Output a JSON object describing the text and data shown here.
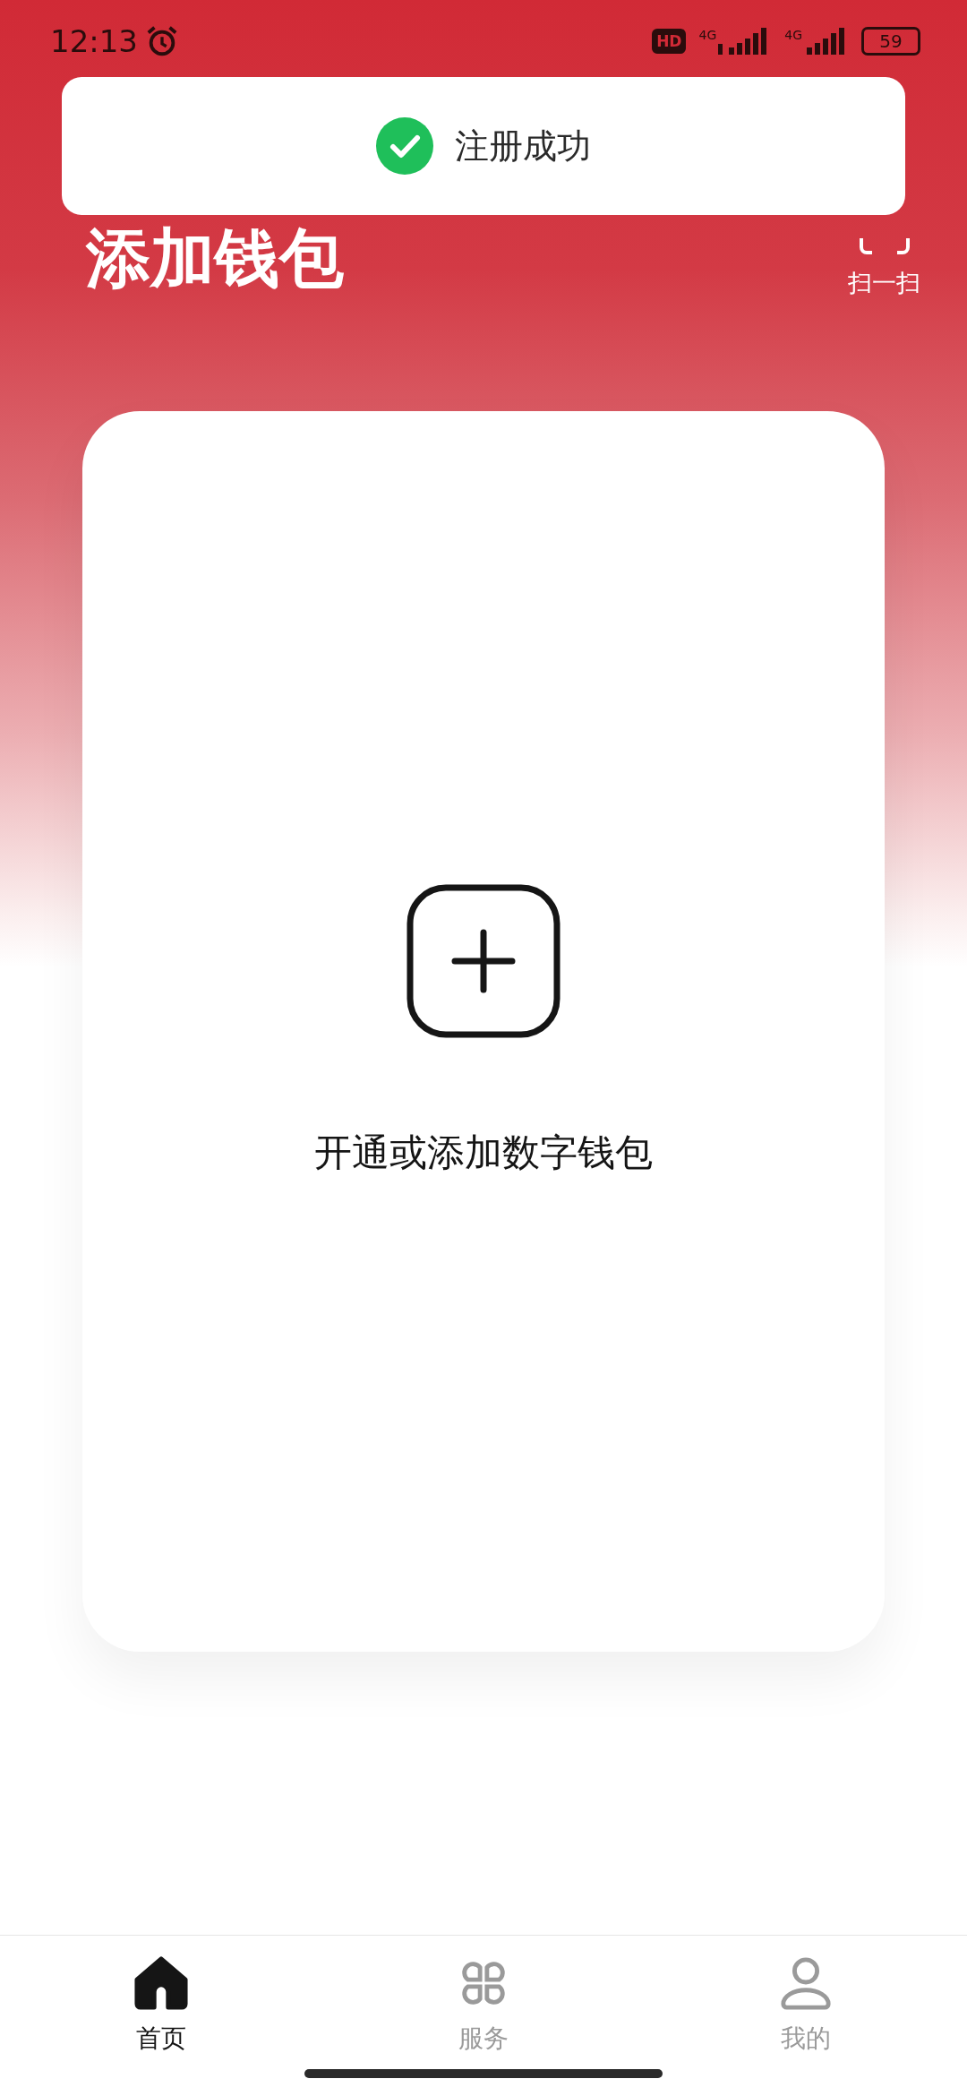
{
  "status_bar": {
    "time": "12:13",
    "hd": "HD",
    "network_1": "4G",
    "network_2": "4G",
    "battery": "59"
  },
  "toast": {
    "text": "注册成功"
  },
  "header": {
    "title": "添加钱包",
    "scan_label": "扫一扫"
  },
  "card": {
    "label": "开通或添加数字钱包"
  },
  "tabs": [
    {
      "label": "首页",
      "kind": "home",
      "selected": true
    },
    {
      "label": "服务",
      "kind": "services",
      "selected": false
    },
    {
      "label": "我的",
      "kind": "profile",
      "selected": false
    }
  ]
}
